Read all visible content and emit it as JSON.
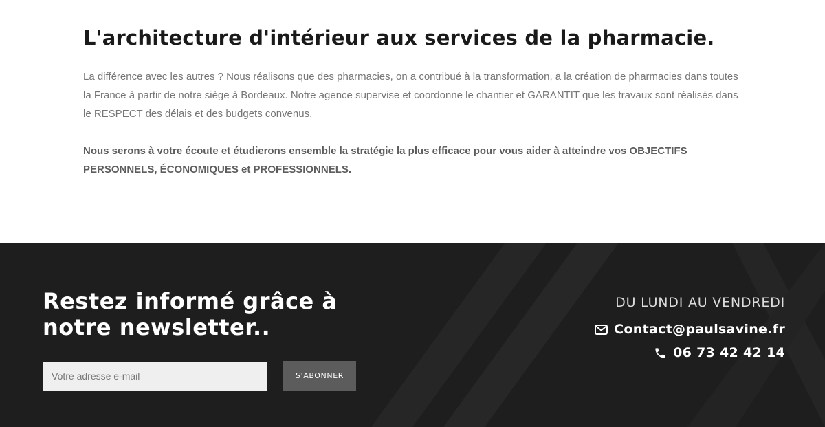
{
  "about": {
    "title": "L'architecture d'intérieur aux services de la pharmacie.",
    "paragraph": "La différence avec les autres ? Nous réalisons que des pharmacies, on a contribué à la transformation, a la création de pharmacies dans toutes la France à partir de notre siège à Bordeaux. Notre agence supervise et coordonne le chantier et GARANTIT que les travaux sont réalisés dans le RESPECT des délais et des budgets convenus.",
    "emphasis": "Nous serons à votre écoute et étudierons ensemble la stratégie la plus efficace pour vous aider à atteindre vos OBJECTIFS PERSONNELS, ÉCONOMIQUES et PROFESSIONNELS."
  },
  "footer": {
    "newsletter_title": "Restez informé grâce à notre newsletter..",
    "email_placeholder": "Votre adresse e-mail",
    "subscribe_label": "S'ABONNER",
    "hours": "DU LUNDI AU VENDREDI",
    "email": "Contact@paulsavine.fr",
    "phone": "06 73 42 42 14",
    "icons": {
      "email": "envelope-icon",
      "phone": "phone-icon"
    },
    "colors": {
      "background": "#1e1e1e",
      "button": "#5c5c5c",
      "input": "#efefef"
    }
  }
}
